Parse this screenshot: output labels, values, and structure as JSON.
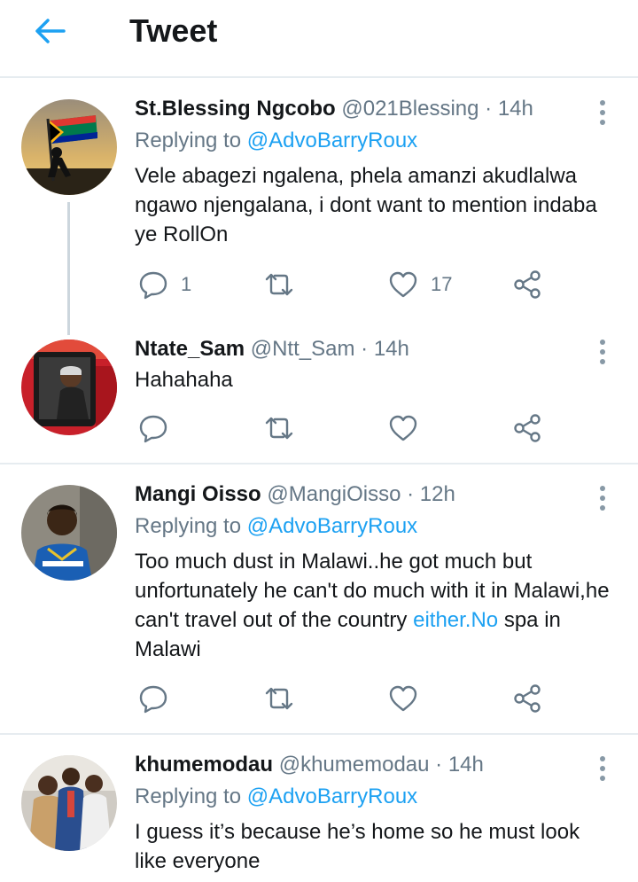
{
  "header": {
    "title": "Tweet",
    "back_icon": "arrow-left-icon",
    "accent": "#1da1f2"
  },
  "tweets": [
    {
      "name": "St.Blessing Ngcobo",
      "handle": "@021Blessing",
      "separator": "·",
      "time": "14h",
      "replying_prefix": "Replying to",
      "replying_to": "@AdvoBarryRoux",
      "text": "Vele abagezi ngalena, phela amanzi akudlalwa ngawo njengalana, i dont want to mention indaba ye RollOn",
      "replies": "1",
      "likes": "17"
    },
    {
      "name": "Ntate_Sam",
      "handle": "@Ntt_Sam",
      "separator": "·",
      "time": "14h",
      "text": "Hahahaha"
    },
    {
      "name": "Mangi Oisso",
      "handle": "@MangiOisso",
      "separator": "·",
      "time": "12h",
      "replying_prefix": "Replying to",
      "replying_to": "@AdvoBarryRoux",
      "text": "Too much dust in Malawi..he got much but unfortunately he can't do much with it in Malawi,he can't travel out of the country ",
      "link": "either.No",
      "text_after": " spa in Malawi"
    },
    {
      "name": "khumemodau",
      "handle": "@khumemodau",
      "separator": "·",
      "time": "14h",
      "replying_prefix": "Replying to",
      "replying_to": "@AdvoBarryRoux",
      "text": "I guess it’s because he’s home so he must look like everyone"
    }
  ]
}
